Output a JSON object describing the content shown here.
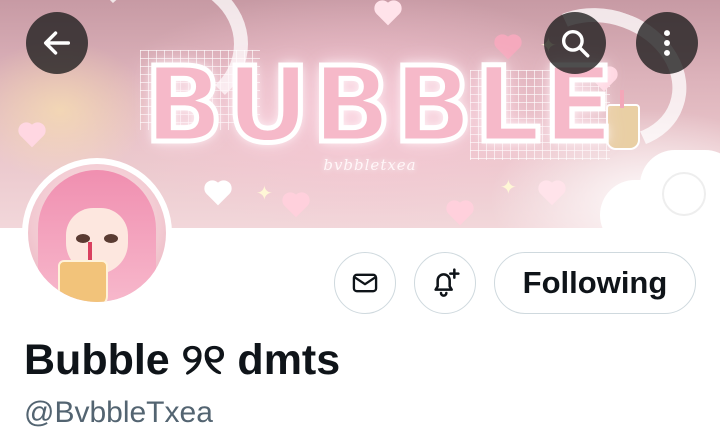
{
  "banner": {
    "title": "BUBBLE",
    "subtitle": "bvbbletxea"
  },
  "nav": {
    "back_icon": "arrow-left-icon",
    "search_icon": "search-icon",
    "more_icon": "more-vertical-icon"
  },
  "actions": {
    "message_icon": "envelope-icon",
    "notify_icon": "bell-plus-icon",
    "follow_label": "Following"
  },
  "profile": {
    "display_name": "Bubble ୨୧ dmts",
    "handle": "@BvbbleTxea"
  },
  "colors": {
    "text_primary": "#0f1419",
    "text_secondary": "#536471",
    "button_border": "#cfd9de",
    "banner_pink": "#f6b9c9"
  }
}
